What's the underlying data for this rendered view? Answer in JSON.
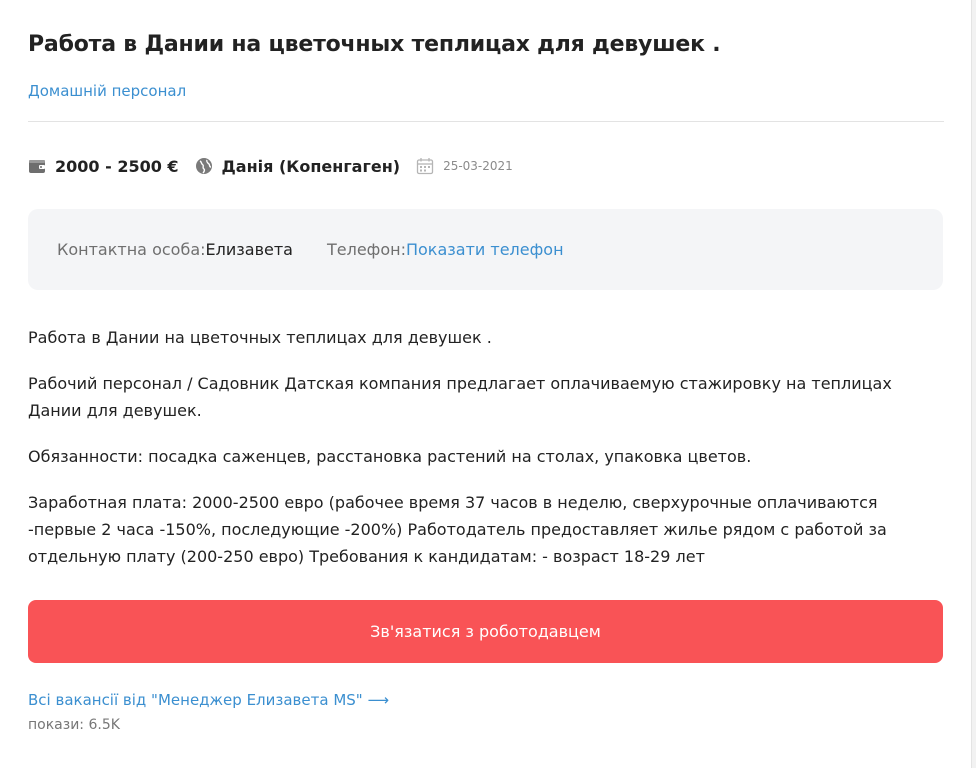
{
  "job": {
    "title": "Работа в Дании на цветочных теплицах для девушек .",
    "category": "Домашній персонал",
    "salary": "2000 - 2500 €",
    "location": "Данія (Копенгаген)",
    "date": "25-03-2021"
  },
  "contact": {
    "person_label": "Контактна особа: ",
    "person_name": "Елизавета",
    "phone_label": "Телефон: ",
    "phone_link": "Показати телефон"
  },
  "description": [
    "Работа в Дании на цветочных теплицах для девушек .",
    "Рабочий персонал / Садовник Датская компания предлагает оплачиваемую стажировку на теплицах Дании для девушек.",
    "Обязанности: посадка саженцев, расстановка растений на столах, упаковка цветов.",
    "Заработная плата: 2000-2500 евро (рабочее время 37 часов в неделю, сверхурочные оплачиваются -первые 2 часа -150%, последующие -200%) Работодатель предоставляет жилье рядом с работой за отдельную плату (200-250 евро) Требования к кандидатам: - возраст 18-29 лет"
  ],
  "actions": {
    "contact_button": "Зв'язатися з роботодавцем",
    "all_vacancies": "Всі вакансії від \"Менеджер Елизавета MS\" ⟶"
  },
  "stats": {
    "views": "покази: 6.5K"
  },
  "icons": {
    "salary": "wallet-icon",
    "location": "globe-icon",
    "date": "calendar-icon"
  },
  "colors": {
    "accent_link": "#3b8fd0",
    "button_bg": "#f95356",
    "contact_box_bg": "#f4f5f7"
  }
}
